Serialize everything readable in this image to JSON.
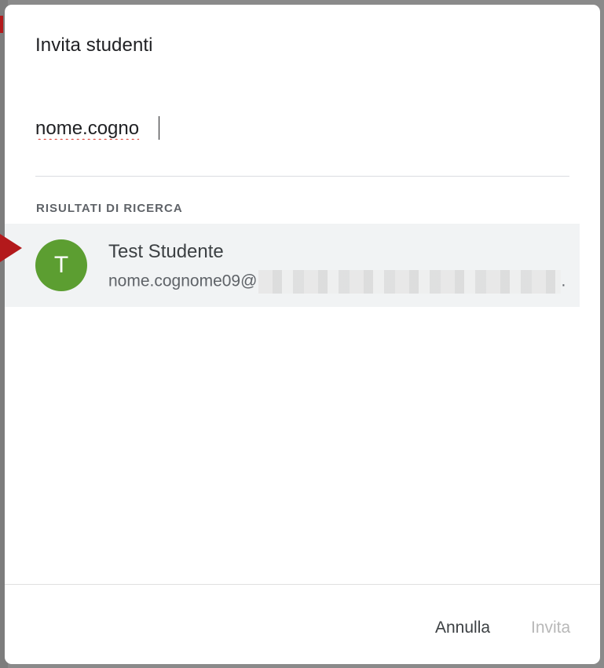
{
  "dialog": {
    "title": "Invita studenti"
  },
  "search": {
    "value": "nome.cogno",
    "placeholder": ""
  },
  "results": {
    "header": "RISULTATI DI RICERCA",
    "items": [
      {
        "avatar_initial": "T",
        "name": "Test Studente",
        "email_visible": "nome.cognome09@",
        "email_suffix": ".",
        "avatar_color": "#5c9e31"
      }
    ]
  },
  "footer": {
    "cancel_label": "Annulla",
    "invite_label": "Invita"
  },
  "annotation": {
    "arrow_color": "#b3191b"
  }
}
